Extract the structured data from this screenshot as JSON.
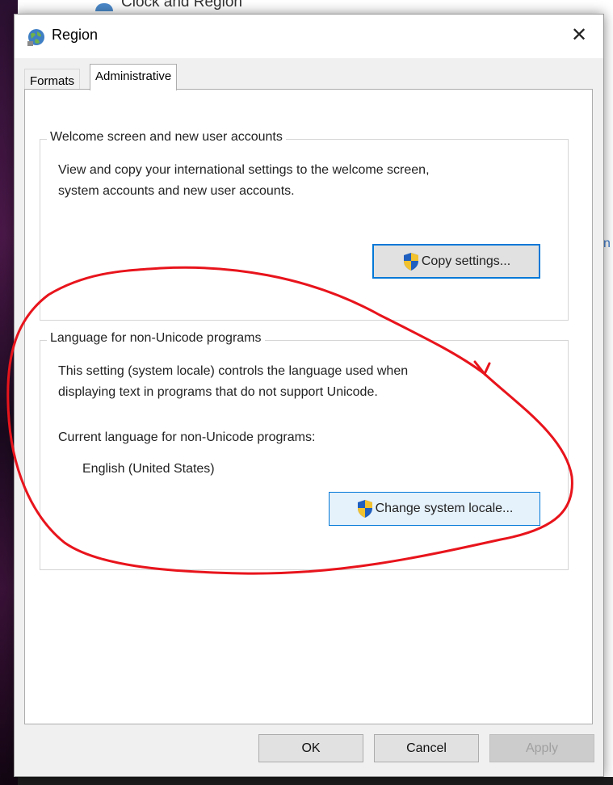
{
  "background": {
    "window_title": "Clock and Region"
  },
  "dialog": {
    "title": "Region",
    "close_label": "✕"
  },
  "tabs": [
    {
      "label": "Formats",
      "selected": false
    },
    {
      "label": "Administrative",
      "selected": true
    }
  ],
  "welcome_group": {
    "legend": "Welcome screen and new user accounts",
    "description_line1": "View and copy your international settings to the welcome screen,",
    "description_line2": "system accounts and new user accounts.",
    "button_label": "Copy settings..."
  },
  "locale_group": {
    "legend": "Language for non-Unicode programs",
    "description_line1": "This setting (system locale) controls the language used when",
    "description_line2": "displaying text in programs that do not support Unicode.",
    "current_label": "Current language for non-Unicode programs:",
    "current_value": "English (United States)",
    "button_label": "Change system locale..."
  },
  "footer": {
    "ok_label": "OK",
    "cancel_label": "Cancel",
    "apply_label": "Apply"
  },
  "colors": {
    "accent": "#0078d7",
    "annotation": "#e8141c"
  }
}
